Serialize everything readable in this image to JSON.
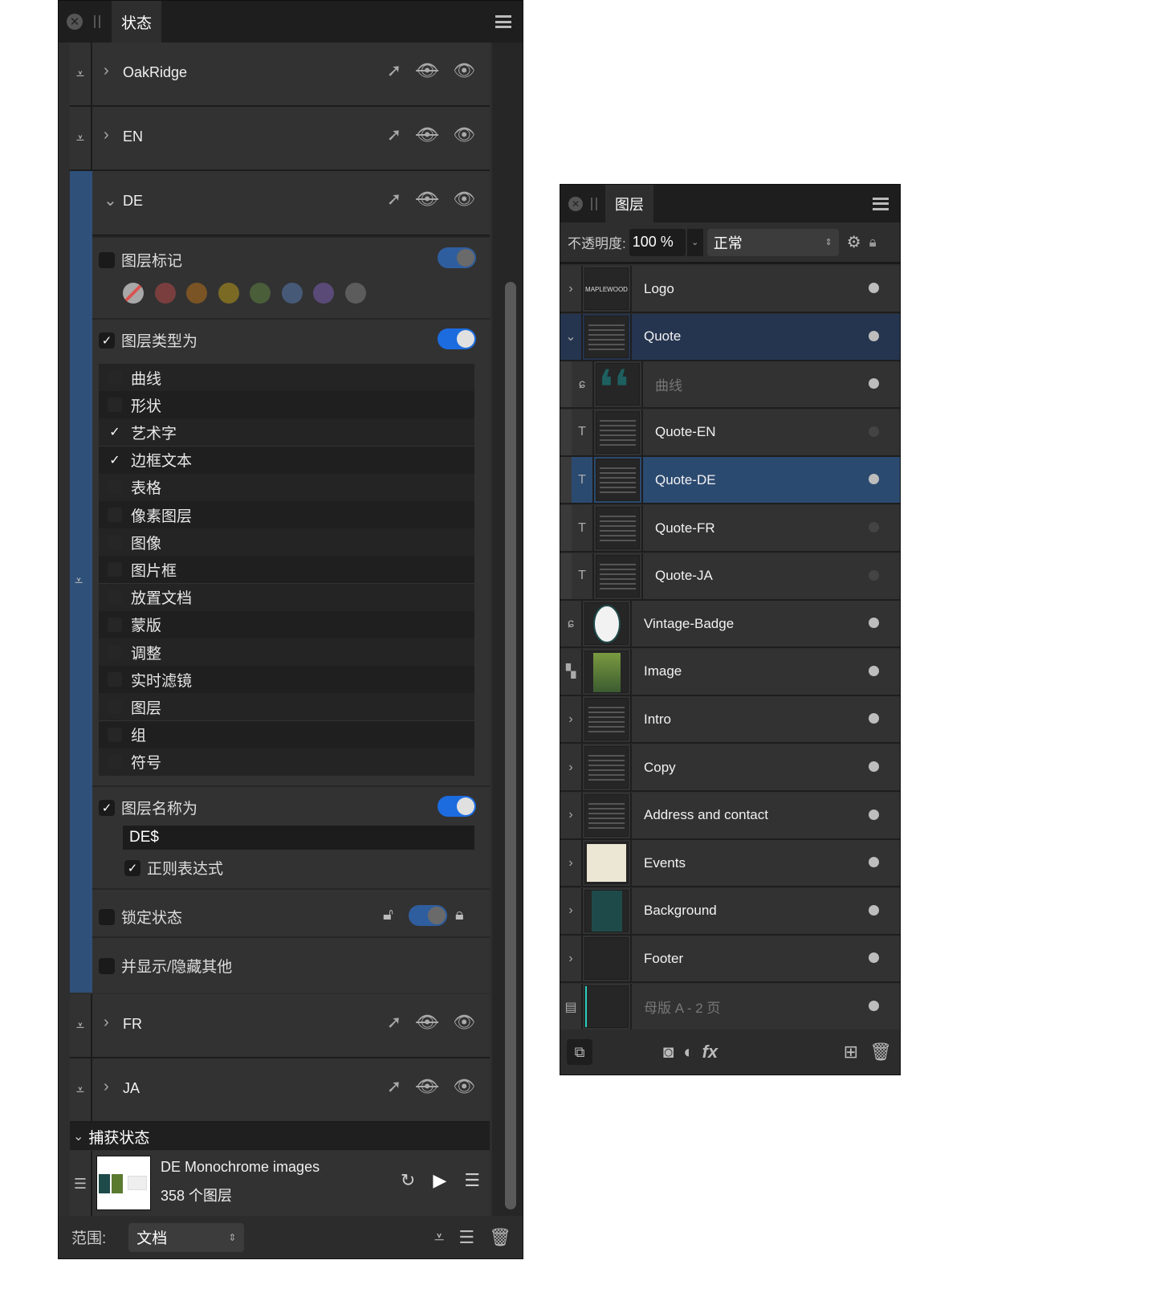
{
  "states_panel": {
    "tab": "状态",
    "states": [
      {
        "name": "OakRidge",
        "expanded": false
      },
      {
        "name": "EN",
        "expanded": false
      },
      {
        "name": "DE",
        "expanded": true
      },
      {
        "name": "FR",
        "expanded": false
      },
      {
        "name": "JA",
        "expanded": false
      }
    ],
    "de": {
      "layer_tag_label": "图层标记",
      "layer_tag_checked": false,
      "layer_tag_toggle": false,
      "tag_colors": [
        "#a8a8a8",
        "#7a3e3e",
        "#7a5424",
        "#7a6a24",
        "#4a5e3a",
        "#465a78",
        "#5a4a78",
        "#5c5c5c"
      ],
      "layer_type_label": "图层类型为",
      "layer_type_checked": true,
      "layer_type_toggle": true,
      "types": [
        {
          "label": "曲线",
          "checked": false
        },
        {
          "label": "形状",
          "checked": false
        },
        {
          "label": "艺术字",
          "checked": true
        },
        {
          "label": "边框文本",
          "checked": true
        },
        {
          "label": "表格",
          "checked": false
        },
        {
          "label": "像素图层",
          "checked": false
        },
        {
          "label": "图像",
          "checked": false
        },
        {
          "label": "图片框",
          "checked": false
        },
        {
          "label": "放置文档",
          "checked": false
        },
        {
          "label": "蒙版",
          "checked": false
        },
        {
          "label": "调整",
          "checked": false
        },
        {
          "label": "实时滤镜",
          "checked": false
        },
        {
          "label": "图层",
          "checked": false
        },
        {
          "label": "组",
          "checked": false
        },
        {
          "label": "符号",
          "checked": false
        }
      ],
      "layer_name_label": "图层名称为",
      "layer_name_checked": true,
      "layer_name_toggle": true,
      "layer_name_value": "DE$",
      "regex_label": "正则表达式",
      "regex_checked": true,
      "lock_label": "锁定状态",
      "lock_checked": false,
      "show_hide_label": "并显示/隐藏其他",
      "show_hide_checked": false
    },
    "capture": {
      "title": "捕获状态",
      "item_name": "DE Monochrome images",
      "item_count": "358 个图层"
    },
    "footer": {
      "scope_label": "范围:",
      "scope_value": "文档"
    }
  },
  "layers_panel": {
    "tab": "图层",
    "opacity_label": "不透明度:",
    "opacity_value": "100 %",
    "blend_mode": "正常",
    "accent": "#2b4a70",
    "layers": [
      {
        "name": "Logo",
        "level": 0,
        "icon": "chevron-right",
        "thumb": "MAPLEWOOD",
        "visible": true
      },
      {
        "name": "Quote",
        "level": 0,
        "icon": "chevron-down",
        "visible": true,
        "parent_selected": true
      },
      {
        "name": "曲线",
        "level": 1,
        "icon": "curve",
        "visible": true,
        "dimmed": true
      },
      {
        "name": "Quote-EN",
        "level": 1,
        "icon": "text-frame",
        "visible": false
      },
      {
        "name": "Quote-DE",
        "level": 1,
        "icon": "text-frame",
        "visible": true,
        "selected": true
      },
      {
        "name": "Quote-FR",
        "level": 1,
        "icon": "text-frame",
        "visible": false
      },
      {
        "name": "Quote-JA",
        "level": 1,
        "icon": "text-frame",
        "visible": false
      },
      {
        "name": "Vintage-Badge",
        "level": 0,
        "icon": "curve",
        "visible": true
      },
      {
        "name": "Image",
        "level": 0,
        "icon": "pixel",
        "visible": true
      },
      {
        "name": "Intro",
        "level": 0,
        "icon": "chevron-right",
        "visible": true
      },
      {
        "name": "Copy",
        "level": 0,
        "icon": "chevron-right",
        "visible": true
      },
      {
        "name": "Address and contact",
        "level": 0,
        "icon": "chevron-right",
        "visible": true
      },
      {
        "name": "Events",
        "level": 0,
        "icon": "chevron-right",
        "visible": true
      },
      {
        "name": "Background",
        "level": 0,
        "icon": "chevron-right",
        "visible": true
      },
      {
        "name": "Footer",
        "level": 0,
        "icon": "chevron-right",
        "visible": true
      },
      {
        "name": "母版 A - 2 页",
        "level": 0,
        "icon": "master-page",
        "visible": true,
        "dimmed": true
      }
    ]
  }
}
